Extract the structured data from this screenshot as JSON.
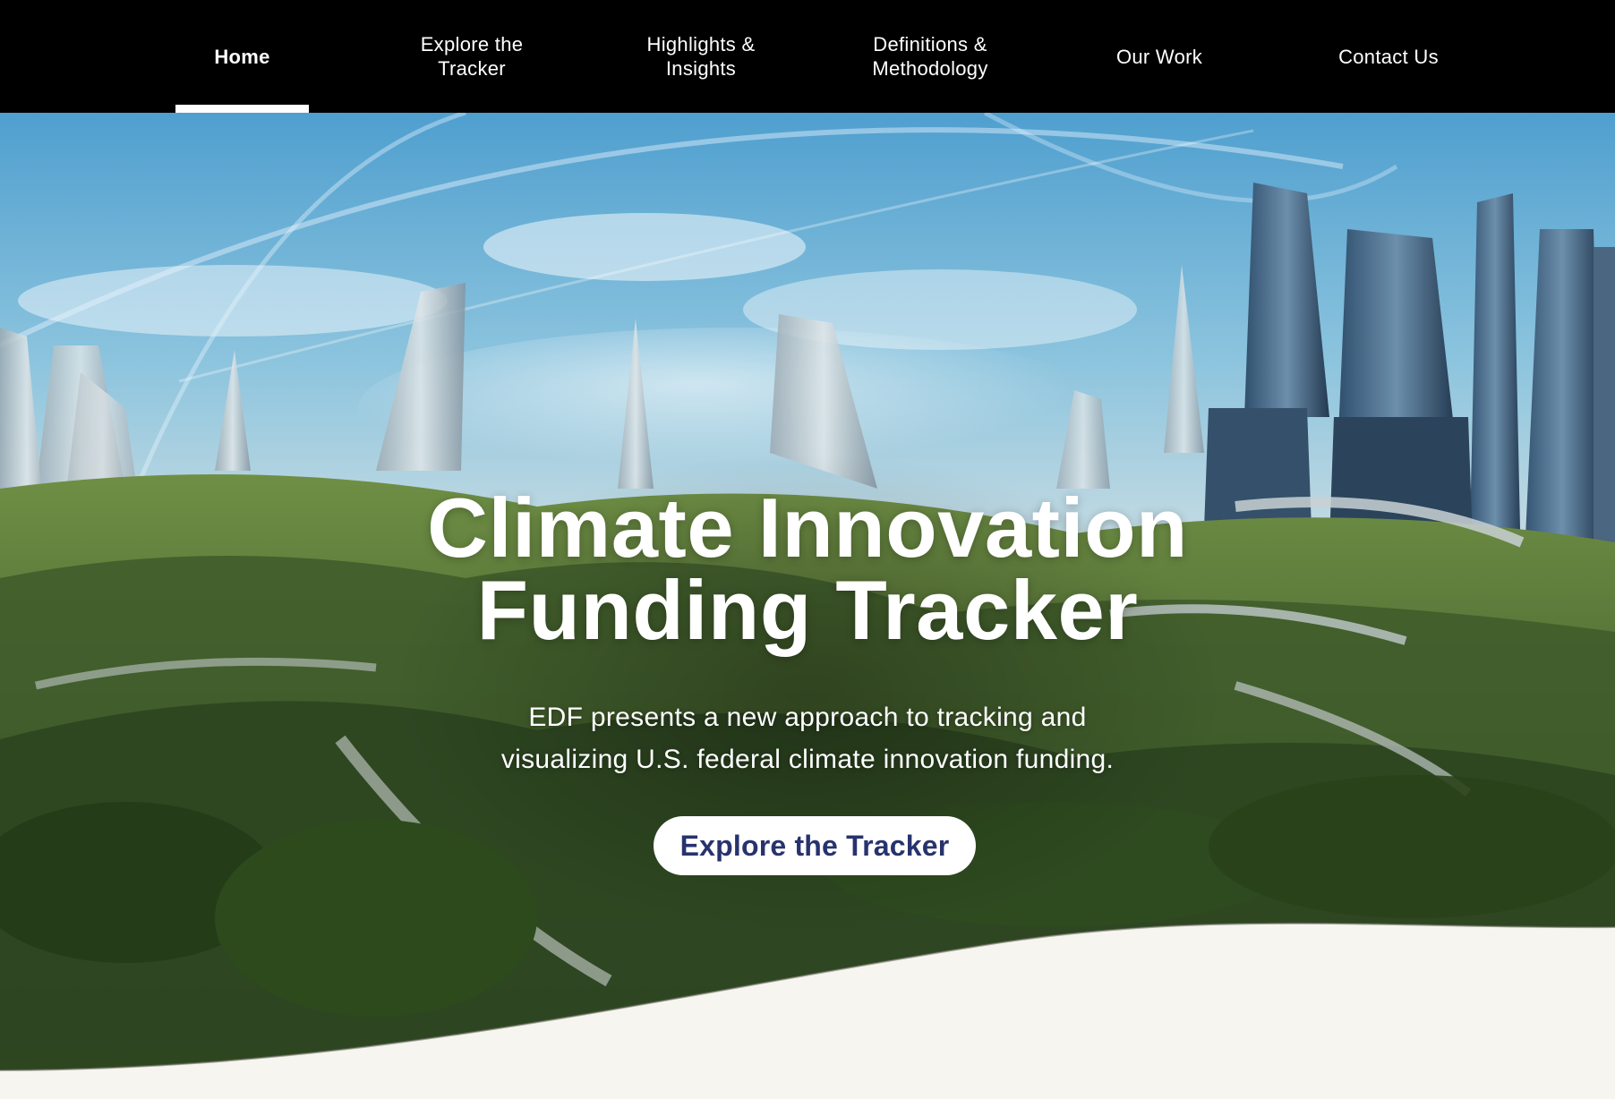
{
  "nav": {
    "items": [
      {
        "label": "Home",
        "active": true
      },
      {
        "label": "Explore the\nTracker",
        "active": false
      },
      {
        "label": "Highlights &\nInsights",
        "active": false
      },
      {
        "label": "Definitions &\nMethodology",
        "active": false
      },
      {
        "label": "Our Work",
        "active": false
      },
      {
        "label": "Contact Us",
        "active": false
      }
    ]
  },
  "hero": {
    "title_line1": "Climate Innovation",
    "title_line2": "Funding Tracker",
    "subtitle_line1": "EDF presents a new approach to tracking and",
    "subtitle_line2": "visualizing U.S. federal climate innovation funding.",
    "cta_label": "Explore the Tracker",
    "image_description": "futuristic green city with glass towers and vegetation"
  },
  "colors": {
    "nav_background": "#000000",
    "nav_text": "#ffffff",
    "cta_text": "#27336e",
    "page_background": "#f6f5f0"
  }
}
